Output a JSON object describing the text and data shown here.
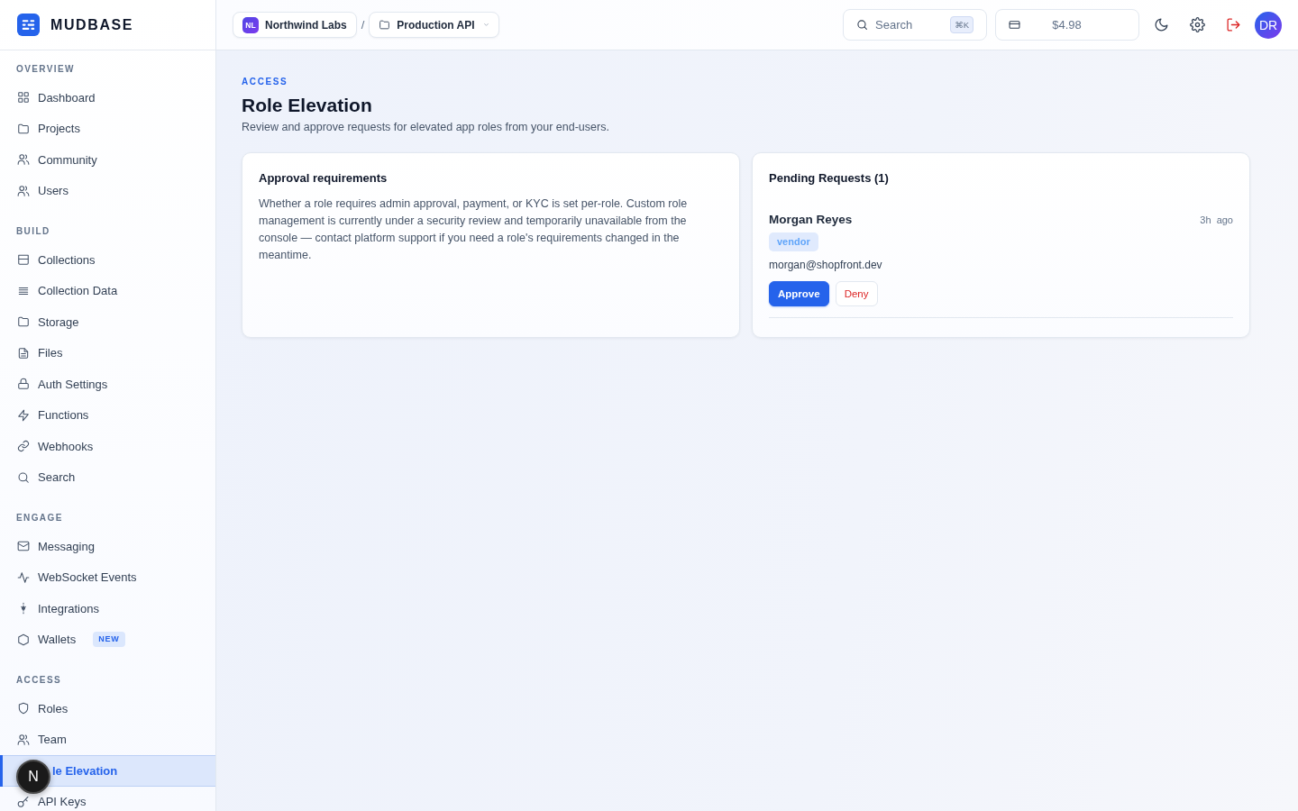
{
  "sidebar": {
    "brand": "MUDBASE",
    "sections": [
      {
        "title": "OVERVIEW",
        "items": [
          {
            "label": "Dashboard",
            "selected": false
          },
          {
            "label": "Projects",
            "selected": false
          },
          {
            "label": "Community",
            "selected": false
          },
          {
            "label": "Users",
            "selected": false
          }
        ]
      },
      {
        "title": "BUILD",
        "items": [
          {
            "label": "Collections",
            "selected": false
          },
          {
            "label": "Collection Data",
            "selected": false
          },
          {
            "label": "Storage",
            "selected": false
          },
          {
            "label": "Files",
            "selected": false
          },
          {
            "label": "Auth Settings",
            "selected": false
          },
          {
            "label": "Functions",
            "selected": false
          },
          {
            "label": "Webhooks",
            "selected": false
          },
          {
            "label": "Search",
            "selected": false
          }
        ]
      },
      {
        "title": "ENGAGE",
        "items": [
          {
            "label": "Messaging",
            "selected": false
          },
          {
            "label": "WebSocket Events",
            "selected": false
          },
          {
            "label": "Integrations",
            "selected": false
          },
          {
            "label": "Wallets",
            "selected": false,
            "badge": "NEW"
          }
        ]
      },
      {
        "title": "ACCESS",
        "items": [
          {
            "label": "Roles",
            "selected": false
          },
          {
            "label": "Team",
            "selected": false
          },
          {
            "label": "le Elevation",
            "selected": true
          },
          {
            "label": "API Keys",
            "selected": false
          }
        ]
      }
    ]
  },
  "header": {
    "breadcrumb": {
      "org_initials": "NL",
      "org_name": "Northwind Labs",
      "separator": "/",
      "project": "Production API"
    },
    "search": {
      "placeholder": "Search",
      "shortcut": "⌘K"
    },
    "balance": "$4.98",
    "avatar": "DR"
  },
  "page": {
    "eyebrow": "ACCESS",
    "title": "Role Elevation",
    "subtitle": "Review and approve requests for elevated app roles from your end-users."
  },
  "approval_card": {
    "title": "Approval requirements",
    "body": "Whether a role requires admin approval, payment, or KYC is set per-role. Custom role management is currently under a security review and temporarily unavailable from the console — contact platform support if you need a role's requirements changed in the meantime."
  },
  "pending_card": {
    "title": "Pending Requests (1)",
    "requests": [
      {
        "name": "Morgan Reyes",
        "time": "3h ago",
        "role": "vendor",
        "email": "morgan@shopfront.dev",
        "actions": [
          {
            "label": "Approve",
            "kind": "primary"
          },
          {
            "label": "Deny",
            "kind": "danger"
          }
        ]
      }
    ]
  },
  "dev_indicator": {
    "label": "N"
  }
}
